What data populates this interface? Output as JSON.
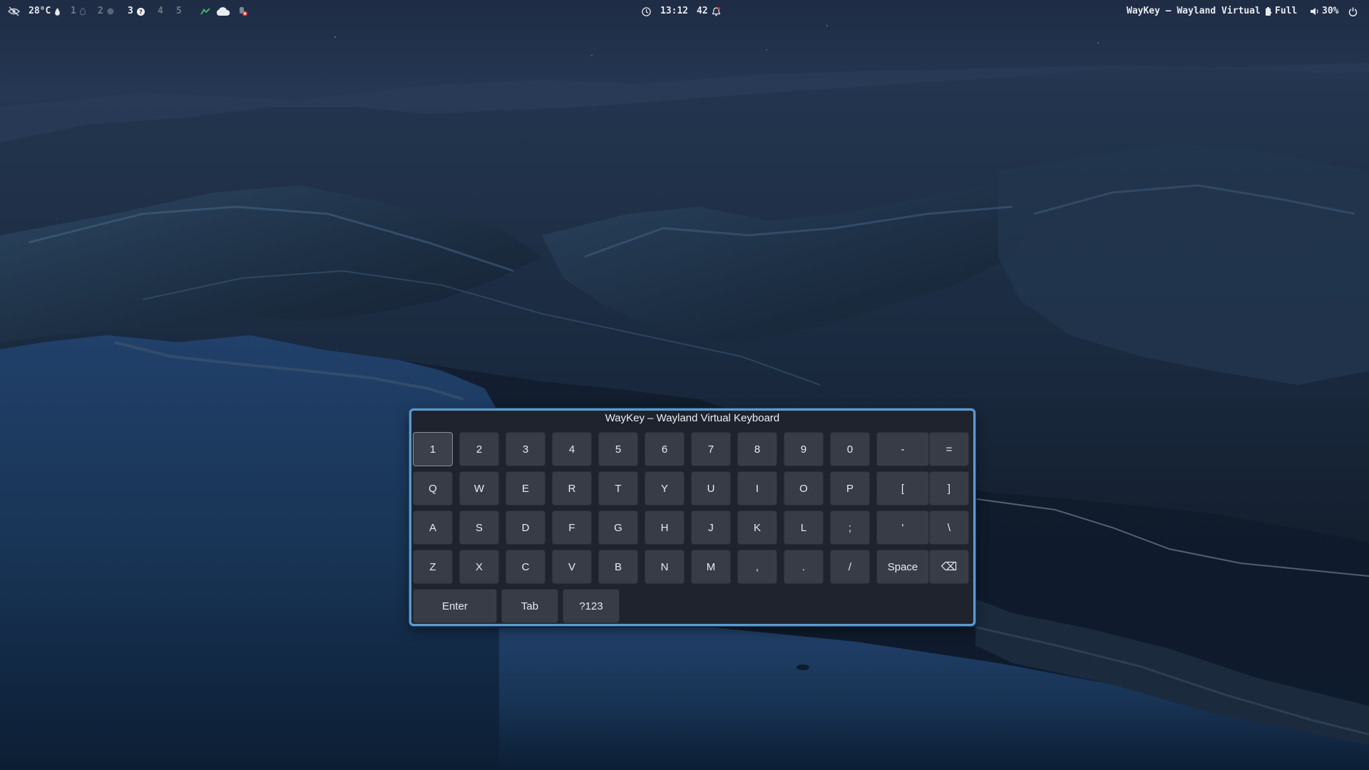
{
  "topbar": {
    "left": {
      "privacy_icon": "eye-slash-icon",
      "temperature": "28°C",
      "temperature_icon": "droplet-icon",
      "workspaces": [
        {
          "label": "1",
          "icon": "flame-icon",
          "active": false
        },
        {
          "label": "2",
          "icon": "dot-icon",
          "active": false
        },
        {
          "label": "3",
          "icon": "help-circle-icon",
          "active": true
        },
        {
          "label": "4",
          "icon": "",
          "active": false
        },
        {
          "label": "5",
          "icon": "",
          "active": false
        }
      ],
      "tray_icons": [
        "nm-applet-icon",
        "cloud-icon",
        "notification-muted-icon"
      ]
    },
    "center": {
      "clock_icon": "clock-icon",
      "time": "13:12",
      "notifications_count": "42",
      "bell_icon": "bell-icon"
    },
    "right": {
      "window_title": "WayKey – Wayland Virtual …",
      "battery_icon": "battery-icon",
      "battery": "Full",
      "volume_icon": "volume-icon",
      "volume": "30%",
      "power_icon": "power-icon"
    }
  },
  "keyboard": {
    "title": "WayKey – Wayland Virtual Keyboard",
    "rows": [
      [
        "1",
        "2",
        "3",
        "4",
        "5",
        "6",
        "7",
        "8",
        "9",
        "0",
        "-",
        "="
      ],
      [
        "Q",
        "W",
        "E",
        "R",
        "T",
        "Y",
        "U",
        "I",
        "O",
        "P",
        "[",
        "]"
      ],
      [
        "A",
        "S",
        "D",
        "F",
        "G",
        "H",
        "J",
        "K",
        "L",
        ";",
        "'",
        "\\"
      ],
      [
        "Z",
        "X",
        "C",
        "V",
        "B",
        "N",
        "M",
        ",",
        ".",
        "/",
        "Space",
        "⌫"
      ],
      [
        "Enter",
        "Tab",
        "?123"
      ]
    ],
    "focused_key": "1"
  },
  "colors": {
    "window_border": "#5a9ccf",
    "window_bg": "#1f232d",
    "key_bg": "#383c46",
    "text": "#e8eaef"
  }
}
